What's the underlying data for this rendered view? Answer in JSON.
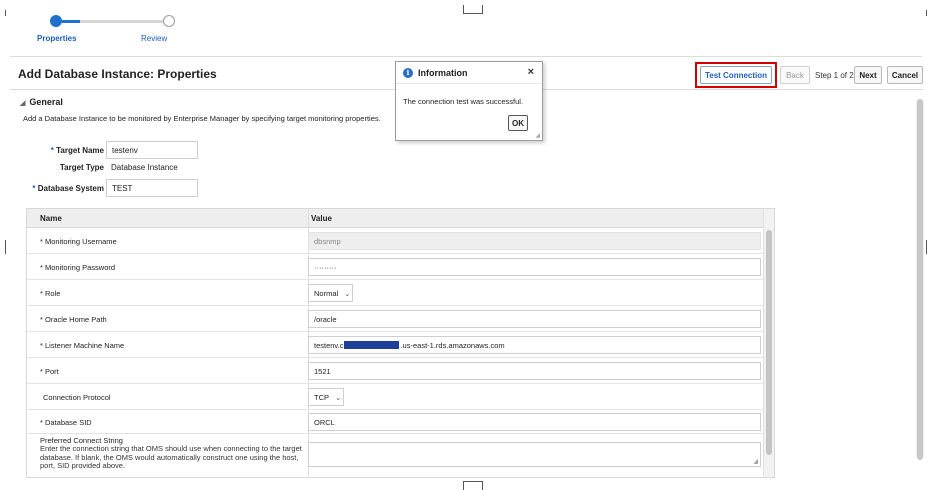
{
  "train": {
    "steps": [
      {
        "label": "Properties",
        "state": "active"
      },
      {
        "label": "Review",
        "state": "pending"
      }
    ]
  },
  "header": {
    "title": "Add Database Instance: Properties",
    "test_connection": "Test Connection",
    "back": "Back",
    "step_text": "Step 1 of 2",
    "next": "Next",
    "cancel": "Cancel"
  },
  "general": {
    "section_title": "General",
    "description": "Add a Database Instance to be monitored by Enterprise Manager by specifying target monitoring properties.",
    "target_name_label": "Target Name",
    "target_name_value": "testenv",
    "target_type_label": "Target Type",
    "target_type_value": "Database Instance",
    "database_system_label": "Database System",
    "database_system_value": "TEST",
    "required_mark": "*"
  },
  "table": {
    "col_name": "Name",
    "col_value": "Value",
    "rows": [
      {
        "name": "* Monitoring Username",
        "value": "dbsnmp"
      },
      {
        "name": "* Monitoring Password",
        "value": "·········"
      },
      {
        "name": "* Role",
        "value": "Normal"
      },
      {
        "name": "* Oracle Home Path",
        "value": "/oracle"
      },
      {
        "name": "* Listener Machine Name",
        "value_prefix": "testenv.c",
        "value_suffix": ".us-east-1.rds.amazonaws.com"
      },
      {
        "name": "* Port",
        "value": "1521"
      },
      {
        "name": "Connection Protocol",
        "value": "TCP"
      },
      {
        "name": "* Database SID",
        "value": "ORCL"
      },
      {
        "name": "Preferred Connect String",
        "help": "Enter the connection string that OMS should use when connecting to the target database. If blank, the OMS would automatically construct one using the host, port, SID provided above."
      }
    ]
  },
  "dialog": {
    "title": "Information",
    "message": "The connection test was successful.",
    "ok": "OK",
    "close_glyph": "×",
    "icon_glyph": "i"
  },
  "colors": {
    "accent": "#1f6fcf",
    "link": "#1f5fb8",
    "highlight_border": "#d40000",
    "redaction": "#1d3f9a"
  }
}
